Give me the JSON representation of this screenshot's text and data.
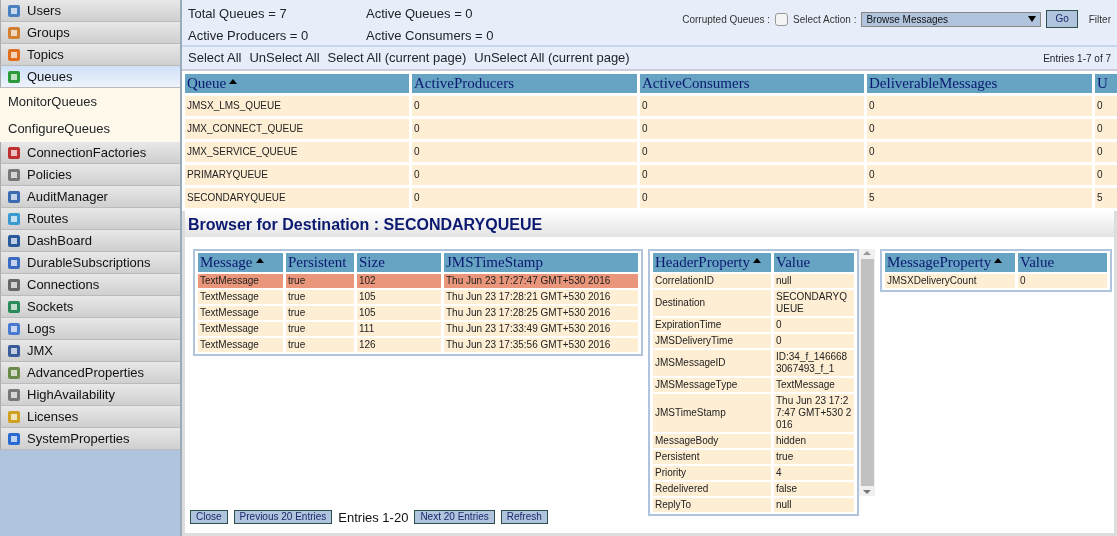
{
  "sidebar": {
    "items": [
      {
        "label": "Users",
        "selected": false
      },
      {
        "label": "Groups",
        "selected": false
      },
      {
        "label": "Topics",
        "selected": false
      },
      {
        "label": "Queues",
        "selected": true,
        "children": [
          {
            "label": "MonitorQueues"
          },
          {
            "label": "ConfigureQueues"
          }
        ]
      },
      {
        "label": "ConnectionFactories",
        "selected": false
      },
      {
        "label": "Policies",
        "selected": false
      },
      {
        "label": "AuditManager",
        "selected": false
      },
      {
        "label": "Routes",
        "selected": false
      },
      {
        "label": "DashBoard",
        "selected": false
      },
      {
        "label": "DurableSubscriptions",
        "selected": false
      },
      {
        "label": "Connections",
        "selected": false
      },
      {
        "label": "Sockets",
        "selected": false
      },
      {
        "label": "Logs",
        "selected": false
      },
      {
        "label": "JMX",
        "selected": false
      },
      {
        "label": "AdvancedProperties",
        "selected": false
      },
      {
        "label": "HighAvailability",
        "selected": false
      },
      {
        "label": "Licenses",
        "selected": false
      },
      {
        "label": "SystemProperties",
        "selected": false
      }
    ]
  },
  "summary": {
    "stats": [
      "Total Queues = 7",
      "Active Queues = 0",
      "Active Producers = 0",
      "Active Consumers = 0"
    ],
    "corrupted_label": "Corrupted Queues :",
    "corrupted_checked": false,
    "action_label": "Select Action :",
    "action_value": "Browse Messages",
    "go": "Go",
    "filter": "Filter"
  },
  "links": [
    "Select All",
    "UnSelect All",
    "Select All (current page)",
    "UnSelect All (current page)"
  ],
  "entries": "Entries 1-7 of 7",
  "queue_table": {
    "columns": [
      {
        "label": "Queue",
        "sorted": true
      },
      {
        "label": "ActiveProducers",
        "sorted": false
      },
      {
        "label": "ActiveConsumers",
        "sorted": false
      },
      {
        "label": "DeliverableMessages",
        "sorted": false
      },
      {
        "label": "U",
        "sorted": false
      }
    ],
    "rows": [
      [
        "JMSX_LMS_QUEUE",
        "0",
        "0",
        "0",
        "0"
      ],
      [
        "JMX_CONNECT_QUEUE",
        "0",
        "0",
        "0",
        "0"
      ],
      [
        "JMX_SERVICE_QUEUE",
        "0",
        "0",
        "0",
        "0"
      ],
      [
        "PRIMARYQUEUE",
        "0",
        "0",
        "0",
        "0"
      ],
      [
        "SECONDARYQUEUE",
        "0",
        "0",
        "5",
        "5"
      ]
    ]
  },
  "browser": {
    "title": "Browser for Destination : SECONDARYQUEUE",
    "messages": {
      "columns": [
        {
          "label": "Message",
          "sorted": true
        },
        {
          "label": "Persistent",
          "sorted": false
        },
        {
          "label": "Size",
          "sorted": false
        },
        {
          "label": "JMSTimeStamp",
          "sorted": false
        }
      ],
      "rows": [
        {
          "selected": true,
          "cells": [
            "TextMessage",
            "true",
            "102",
            "Thu Jun 23 17:27:47 GMT+530 2016"
          ]
        },
        {
          "selected": false,
          "cells": [
            "TextMessage",
            "true",
            "105",
            "Thu Jun 23 17:28:21 GMT+530 2016"
          ]
        },
        {
          "selected": false,
          "cells": [
            "TextMessage",
            "true",
            "105",
            "Thu Jun 23 17:28:25 GMT+530 2016"
          ]
        },
        {
          "selected": false,
          "cells": [
            "TextMessage",
            "true",
            "111",
            "Thu Jun 23 17:33:49 GMT+530 2016"
          ]
        },
        {
          "selected": false,
          "cells": [
            "TextMessage",
            "true",
            "126",
            "Thu Jun 23 17:35:56 GMT+530 2016"
          ]
        }
      ]
    },
    "headers": {
      "columns": [
        {
          "label": "HeaderProperty",
          "sorted": true
        },
        {
          "label": "Value",
          "sorted": false
        }
      ],
      "rows": [
        [
          "CorrelationID",
          "null"
        ],
        [
          "Destination",
          "SECONDARYQUEUE"
        ],
        [
          "ExpirationTime",
          "0"
        ],
        [
          "JMSDeliveryTime",
          "0"
        ],
        [
          "JMSMessageID",
          "ID:34_f_1466683067493_f_1"
        ],
        [
          "JMSMessageType",
          "TextMessage"
        ],
        [
          "JMSTimeStamp",
          "Thu Jun 23 17:27:47 GMT+530 2016"
        ],
        [
          "MessageBody",
          "hidden"
        ],
        [
          "Persistent",
          "true"
        ],
        [
          "Priority",
          "4"
        ],
        [
          "Redelivered",
          "false"
        ],
        [
          "ReplyTo",
          "null"
        ]
      ]
    },
    "properties": {
      "columns": [
        {
          "label": "MessageProperty",
          "sorted": true
        },
        {
          "label": "Value",
          "sorted": false
        }
      ],
      "rows": [
        [
          "JMSXDeliveryCount",
          "0"
        ]
      ]
    },
    "footer": {
      "close": "Close",
      "previous": "Previous 20 Entries",
      "entries": "Entries 1-20",
      "next": "Next 20 Entries",
      "refresh": "Refresh"
    }
  }
}
